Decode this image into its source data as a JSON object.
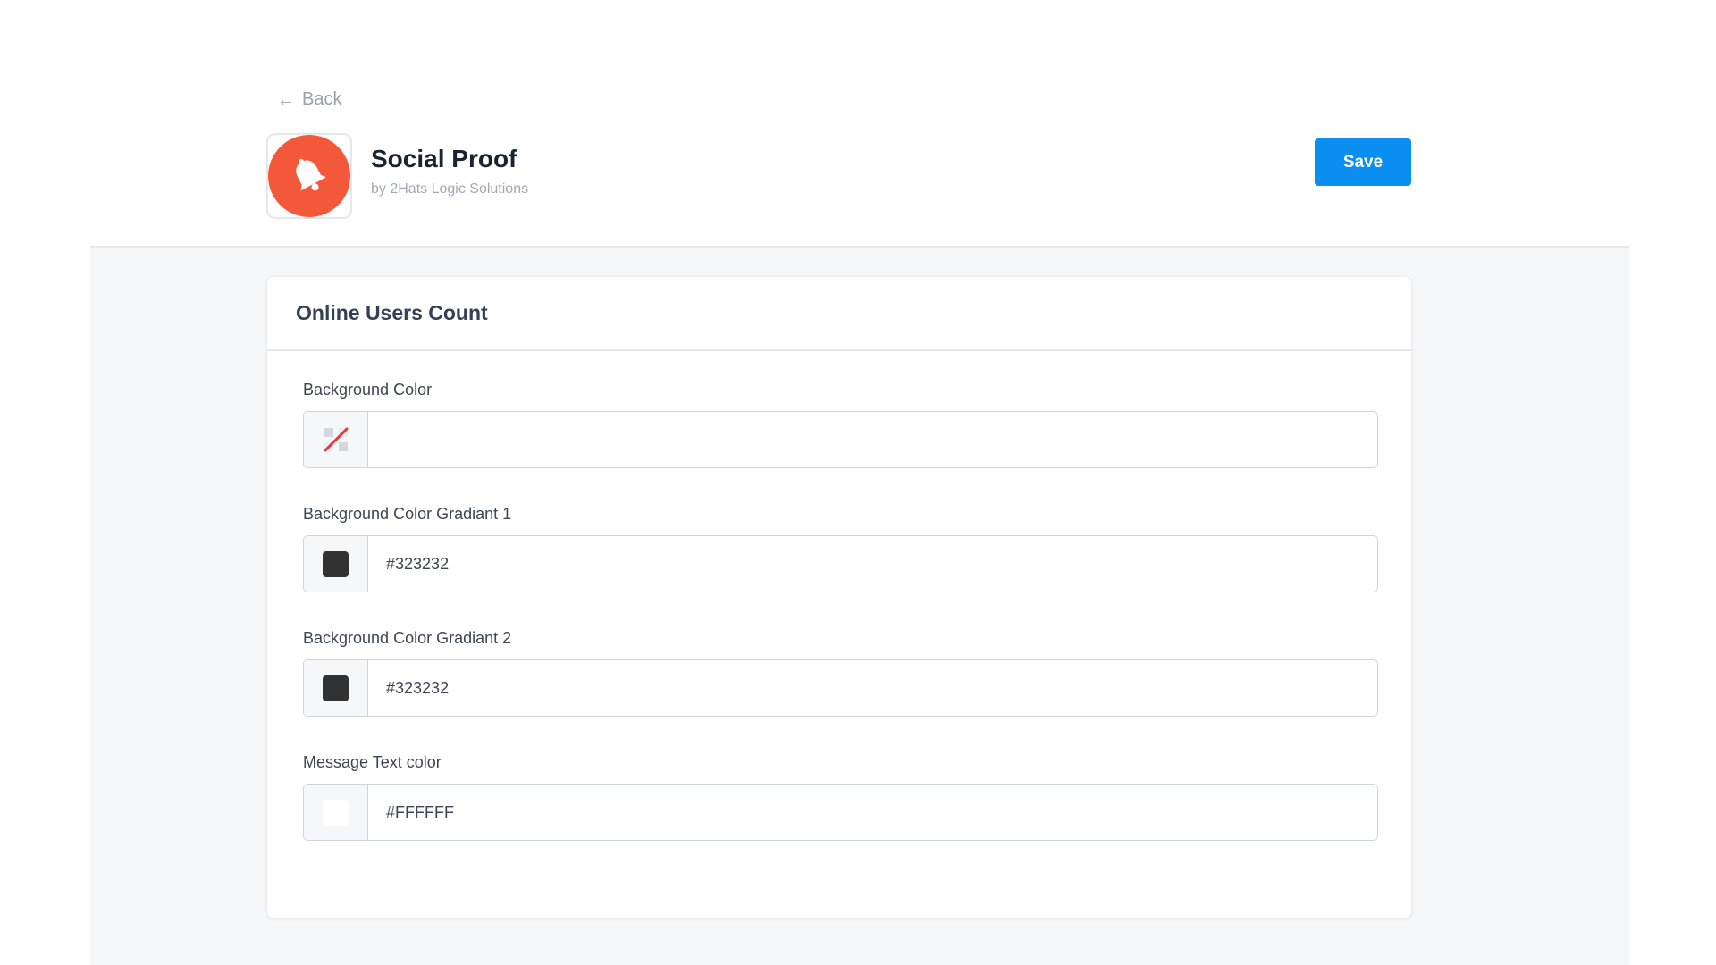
{
  "header": {
    "back_label": "Back",
    "app_title": "Social Proof",
    "app_subtitle": "by 2Hats Logic Solutions",
    "save_label": "Save",
    "app_icon": "bell-icon",
    "app_icon_color": "#f4583a",
    "save_color": "#0a8ef0"
  },
  "card": {
    "title": "Online Users Count",
    "fields": [
      {
        "label": "Background Color",
        "value": "",
        "swatch": "transparent",
        "swatch_icon": "no-color-icon"
      },
      {
        "label": "Background Color Gradiant 1",
        "value": "#323232",
        "swatch": "#323232"
      },
      {
        "label": "Background Color Gradiant 2",
        "value": "#323232",
        "swatch": "#323232"
      },
      {
        "label": "Message Text color",
        "value": "#FFFFFF",
        "swatch": "#FFFFFF"
      }
    ]
  }
}
